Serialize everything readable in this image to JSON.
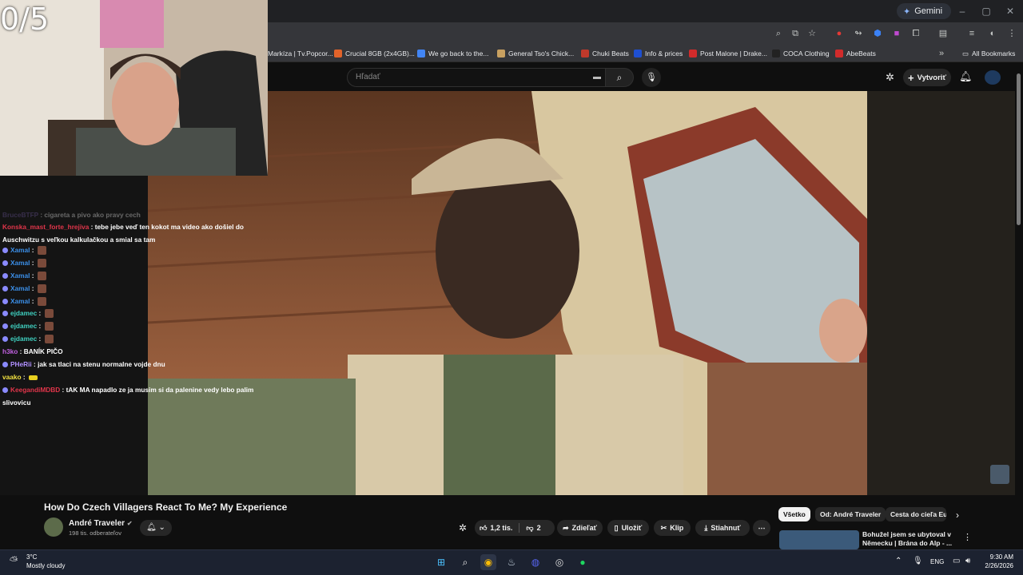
{
  "overlay": {
    "counter": "0/5"
  },
  "browser": {
    "gemini_label": "Gemini",
    "bookmarks": [
      {
        "label": "Markíza | Tv.Popcor...",
        "color": "#3a3a3a"
      },
      {
        "label": "Crucial 8GB (2x4GB)...",
        "color": "#e2632a"
      },
      {
        "label": "We go back to the...",
        "color": "#4285f4"
      },
      {
        "label": "General Tso's Chick...",
        "color": "#c8a060"
      },
      {
        "label": "Chuki Beats",
        "color": "#c0392b"
      },
      {
        "label": "Info & prices",
        "color": "#1e4fd1"
      },
      {
        "label": "Post Malone | Drake...",
        "color": "#d12b2b"
      },
      {
        "label": "COCA Clothing",
        "color": "#222222"
      },
      {
        "label": "AbeBeats",
        "color": "#d12b2b"
      }
    ],
    "all_bookmarks": "All Bookmarks"
  },
  "youtube": {
    "search_placeholder": "Hľadať",
    "create_label": "Vytvoriť",
    "video_title": "How Do Czech Villagers React To Me? My Experience",
    "channel_name": "André Traveler",
    "subscribers": "198 tis. odberateľov",
    "likes": "1,2 tis.",
    "dislikes": "2",
    "share_label": "Zdieľať",
    "save_label": "Uložiť",
    "clip_label": "Klip",
    "download_label": "Stiahnuť",
    "chips": [
      "Všetko",
      "Od: André Traveler",
      "Cesta do cieľa Eu"
    ],
    "rec_title_line1": "Bohužel jsem se ubytoval v",
    "rec_title_line2": "Německu | Brána do Alp - ..."
  },
  "chat": [
    {
      "user": "BruceBTFP",
      "text": "cigareta a pivo ako pravy cech",
      "color": "#7a5fb0",
      "dim": true
    },
    {
      "user": "Konska_mast_forte_hrejiva",
      "text": "tebe jebe veď ten kokot ma video ako došiel do Auschwitzu s veľkou kalkulačkou a smial sa tam",
      "color": "#e0354a"
    },
    {
      "user": "Xamal",
      "text": "",
      "color": "#3b8fe8",
      "emote": true
    },
    {
      "user": "Xamal",
      "text": "",
      "color": "#3b8fe8",
      "emote": true
    },
    {
      "user": "Xamal",
      "text": "",
      "color": "#3b8fe8",
      "emote": true
    },
    {
      "user": "Xamal",
      "text": "",
      "color": "#3b8fe8",
      "emote": true
    },
    {
      "user": "Xamal",
      "text": "",
      "color": "#3b8fe8",
      "emote": true
    },
    {
      "user": "ejdamec",
      "text": "",
      "color": "#3fd0c0",
      "emote": true
    },
    {
      "user": "ejdamec",
      "text": "",
      "color": "#3fd0c0",
      "emote": true
    },
    {
      "user": "ejdamec",
      "text": "",
      "color": "#3fd0c0",
      "emote": true
    },
    {
      "user": "h3ko",
      "text": "BANÍK PIČO",
      "color": "#c060e0"
    },
    {
      "user": "PHeRii",
      "text": "jak sa tlaci na stenu normalne vojde dnu",
      "color": "#b090ff"
    },
    {
      "user": "vaako",
      "text": "",
      "color": "#f0e040",
      "emote": true
    },
    {
      "user": "KeegandiMDBD",
      "text": "tAK MA napadlo ze ja musim si da palenine vedy lebo palim slivovicu",
      "color": "#e0354a"
    }
  ],
  "taskbar": {
    "temp": "3°C",
    "weather": "Mostly cloudy",
    "lang": "ENG",
    "time": "9:30 AM",
    "date": "2/26/2026"
  }
}
